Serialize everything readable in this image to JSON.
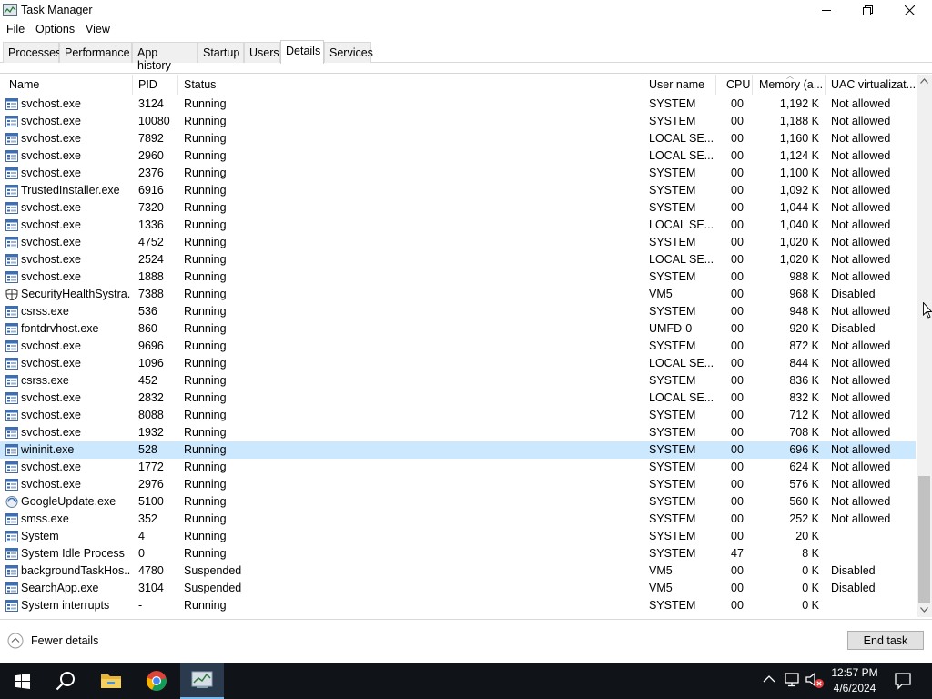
{
  "window": {
    "title": "Task Manager"
  },
  "menu": [
    "File",
    "Options",
    "View"
  ],
  "tabs": [
    "Processes",
    "Performance",
    "App history",
    "Startup",
    "Users",
    "Details",
    "Services"
  ],
  "active_tab": "Details",
  "columns": [
    "Name",
    "PID",
    "Status",
    "User name",
    "CPU",
    "Memory (a...",
    "UAC virtualizat..."
  ],
  "rows": [
    {
      "name": "svchost.exe",
      "pid": "3124",
      "status": "Running",
      "user": "SYSTEM",
      "cpu": "00",
      "mem": "1,192 K",
      "uac": "Not allowed",
      "icon": "service-icon"
    },
    {
      "name": "svchost.exe",
      "pid": "10080",
      "status": "Running",
      "user": "SYSTEM",
      "cpu": "00",
      "mem": "1,188 K",
      "uac": "Not allowed",
      "icon": "service-icon"
    },
    {
      "name": "svchost.exe",
      "pid": "7892",
      "status": "Running",
      "user": "LOCAL SE...",
      "cpu": "00",
      "mem": "1,160 K",
      "uac": "Not allowed",
      "icon": "service-icon"
    },
    {
      "name": "svchost.exe",
      "pid": "2960",
      "status": "Running",
      "user": "LOCAL SE...",
      "cpu": "00",
      "mem": "1,124 K",
      "uac": "Not allowed",
      "icon": "service-icon"
    },
    {
      "name": "svchost.exe",
      "pid": "2376",
      "status": "Running",
      "user": "SYSTEM",
      "cpu": "00",
      "mem": "1,100 K",
      "uac": "Not allowed",
      "icon": "service-icon"
    },
    {
      "name": "TrustedInstaller.exe",
      "pid": "6916",
      "status": "Running",
      "user": "SYSTEM",
      "cpu": "00",
      "mem": "1,092 K",
      "uac": "Not allowed",
      "icon": "service-icon"
    },
    {
      "name": "svchost.exe",
      "pid": "7320",
      "status": "Running",
      "user": "SYSTEM",
      "cpu": "00",
      "mem": "1,044 K",
      "uac": "Not allowed",
      "icon": "service-icon"
    },
    {
      "name": "svchost.exe",
      "pid": "1336",
      "status": "Running",
      "user": "LOCAL SE...",
      "cpu": "00",
      "mem": "1,040 K",
      "uac": "Not allowed",
      "icon": "service-icon"
    },
    {
      "name": "svchost.exe",
      "pid": "4752",
      "status": "Running",
      "user": "SYSTEM",
      "cpu": "00",
      "mem": "1,020 K",
      "uac": "Not allowed",
      "icon": "service-icon"
    },
    {
      "name": "svchost.exe",
      "pid": "2524",
      "status": "Running",
      "user": "LOCAL SE...",
      "cpu": "00",
      "mem": "1,020 K",
      "uac": "Not allowed",
      "icon": "service-icon"
    },
    {
      "name": "svchost.exe",
      "pid": "1888",
      "status": "Running",
      "user": "SYSTEM",
      "cpu": "00",
      "mem": "988 K",
      "uac": "Not allowed",
      "icon": "service-icon"
    },
    {
      "name": "SecurityHealthSystra...",
      "pid": "7388",
      "status": "Running",
      "user": "VM5",
      "cpu": "00",
      "mem": "968 K",
      "uac": "Disabled",
      "icon": "shield-icon"
    },
    {
      "name": "csrss.exe",
      "pid": "536",
      "status": "Running",
      "user": "SYSTEM",
      "cpu": "00",
      "mem": "948 K",
      "uac": "Not allowed",
      "icon": "service-icon"
    },
    {
      "name": "fontdrvhost.exe",
      "pid": "860",
      "status": "Running",
      "user": "UMFD-0",
      "cpu": "00",
      "mem": "920 K",
      "uac": "Disabled",
      "icon": "service-icon"
    },
    {
      "name": "svchost.exe",
      "pid": "9696",
      "status": "Running",
      "user": "SYSTEM",
      "cpu": "00",
      "mem": "872 K",
      "uac": "Not allowed",
      "icon": "service-icon"
    },
    {
      "name": "svchost.exe",
      "pid": "1096",
      "status": "Running",
      "user": "LOCAL SE...",
      "cpu": "00",
      "mem": "844 K",
      "uac": "Not allowed",
      "icon": "service-icon"
    },
    {
      "name": "csrss.exe",
      "pid": "452",
      "status": "Running",
      "user": "SYSTEM",
      "cpu": "00",
      "mem": "836 K",
      "uac": "Not allowed",
      "icon": "service-icon"
    },
    {
      "name": "svchost.exe",
      "pid": "2832",
      "status": "Running",
      "user": "LOCAL SE...",
      "cpu": "00",
      "mem": "832 K",
      "uac": "Not allowed",
      "icon": "service-icon"
    },
    {
      "name": "svchost.exe",
      "pid": "8088",
      "status": "Running",
      "user": "SYSTEM",
      "cpu": "00",
      "mem": "712 K",
      "uac": "Not allowed",
      "icon": "service-icon"
    },
    {
      "name": "svchost.exe",
      "pid": "1932",
      "status": "Running",
      "user": "SYSTEM",
      "cpu": "00",
      "mem": "708 K",
      "uac": "Not allowed",
      "icon": "service-icon"
    },
    {
      "name": "wininit.exe",
      "pid": "528",
      "status": "Running",
      "user": "SYSTEM",
      "cpu": "00",
      "mem": "696 K",
      "uac": "Not allowed",
      "icon": "service-icon",
      "selected": true
    },
    {
      "name": "svchost.exe",
      "pid": "1772",
      "status": "Running",
      "user": "SYSTEM",
      "cpu": "00",
      "mem": "624 K",
      "uac": "Not allowed",
      "icon": "service-icon"
    },
    {
      "name": "svchost.exe",
      "pid": "2976",
      "status": "Running",
      "user": "SYSTEM",
      "cpu": "00",
      "mem": "576 K",
      "uac": "Not allowed",
      "icon": "service-icon"
    },
    {
      "name": "GoogleUpdate.exe",
      "pid": "5100",
      "status": "Running",
      "user": "SYSTEM",
      "cpu": "00",
      "mem": "560 K",
      "uac": "Not allowed",
      "icon": "google-update-icon"
    },
    {
      "name": "smss.exe",
      "pid": "352",
      "status": "Running",
      "user": "SYSTEM",
      "cpu": "00",
      "mem": "252 K",
      "uac": "Not allowed",
      "icon": "service-icon"
    },
    {
      "name": "System",
      "pid": "4",
      "status": "Running",
      "user": "SYSTEM",
      "cpu": "00",
      "mem": "20 K",
      "uac": "",
      "icon": "service-icon"
    },
    {
      "name": "System Idle Process",
      "pid": "0",
      "status": "Running",
      "user": "SYSTEM",
      "cpu": "47",
      "mem": "8 K",
      "uac": "",
      "icon": "service-icon"
    },
    {
      "name": "backgroundTaskHos...",
      "pid": "4780",
      "status": "Suspended",
      "user": "VM5",
      "cpu": "00",
      "mem": "0 K",
      "uac": "Disabled",
      "icon": "service-icon"
    },
    {
      "name": "SearchApp.exe",
      "pid": "3104",
      "status": "Suspended",
      "user": "VM5",
      "cpu": "00",
      "mem": "0 K",
      "uac": "Disabled",
      "icon": "service-icon"
    },
    {
      "name": "System interrupts",
      "pid": "-",
      "status": "Running",
      "user": "SYSTEM",
      "cpu": "00",
      "mem": "0 K",
      "uac": "",
      "icon": "service-icon"
    }
  ],
  "footer": {
    "fewer_details": "Fewer details",
    "end_task": "End task"
  },
  "taskbar": {
    "items": [
      "start-icon",
      "search-icon",
      "file-explorer-icon",
      "chrome-icon",
      "task-manager-icon"
    ],
    "time": "12:57 PM",
    "date": "4/6/2024"
  },
  "colors": {
    "selection": "#cce8ff",
    "taskbar": "#101418",
    "accent": "#76b9ed"
  }
}
